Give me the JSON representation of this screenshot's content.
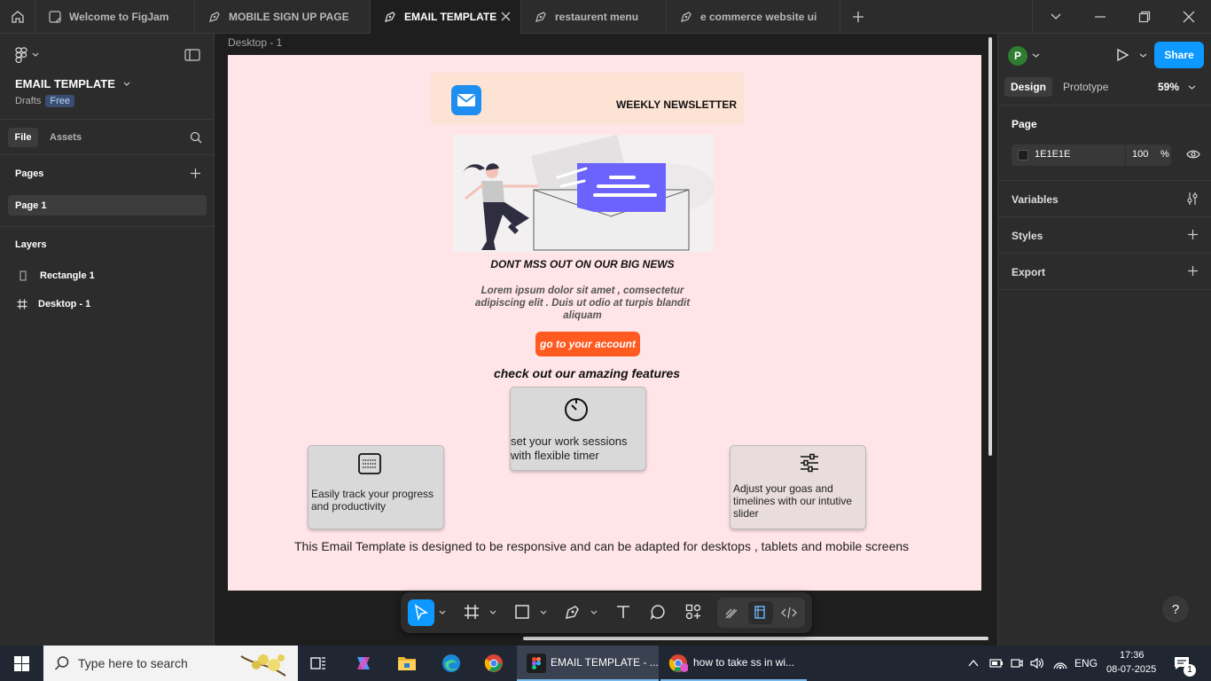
{
  "tabs": [
    {
      "label": "Welcome to FigJam"
    },
    {
      "label": "MOBILE SIGN UP PAGE"
    },
    {
      "label": "EMAIL TEMPLATE"
    },
    {
      "label": "restaurent menu"
    },
    {
      "label": "e commerce website ui"
    }
  ],
  "left": {
    "file_title": "EMAIL TEMPLATE",
    "drafts": "Drafts",
    "plan_badge": "Free",
    "tab_file": "File",
    "tab_assets": "Assets",
    "pages_header": "Pages",
    "pages": [
      "Page 1"
    ],
    "layers_header": "Layers",
    "layers": [
      "Rectangle 1",
      "Desktop - 1"
    ]
  },
  "canvas": {
    "frame_label": "Desktop - 1",
    "newsletter": "WEEKLY NEWSLETTER",
    "headline": "DONT MSS OUT ON  OUR BIG NEWS",
    "lorem": "Lorem ipsum dolor sit amet , comsectetur adipiscing elit . Duis ut odio at turpis blandit aliquam",
    "cta": "go to your account",
    "features_title": "check out our amazing features",
    "feature_center": "set your work sessions with flexible timer",
    "feature_left": "Easily track your progress and productivity",
    "feature_right": "Adjust your goas and timelines with our intutive slider",
    "footer": "This Email Template is designed to be responsive and can be adapted for desktops , tablets and mobile screens"
  },
  "right": {
    "avatar": "P",
    "share": "Share",
    "tab_design": "Design",
    "tab_prototype": "Prototype",
    "zoom": "59%",
    "page_header": "Page",
    "page_color": "1E1E1E",
    "page_opacity": "100",
    "percent": "%",
    "variables": "Variables",
    "styles": "Styles",
    "export": "Export",
    "help": "?"
  },
  "taskbar": {
    "search_placeholder": "Type here to search",
    "figma_task": "EMAIL TEMPLATE - ...",
    "chrome_task": "how to take ss in wi...",
    "lang": "ENG",
    "time": "17:36",
    "date": "08-07-2025",
    "notif_count": "1"
  },
  "colors": {
    "accent": "#0d99ff",
    "cta_orange": "#ff5a1f",
    "frame_bg": "#ffe4e8",
    "header_band": "#fde3d3"
  }
}
